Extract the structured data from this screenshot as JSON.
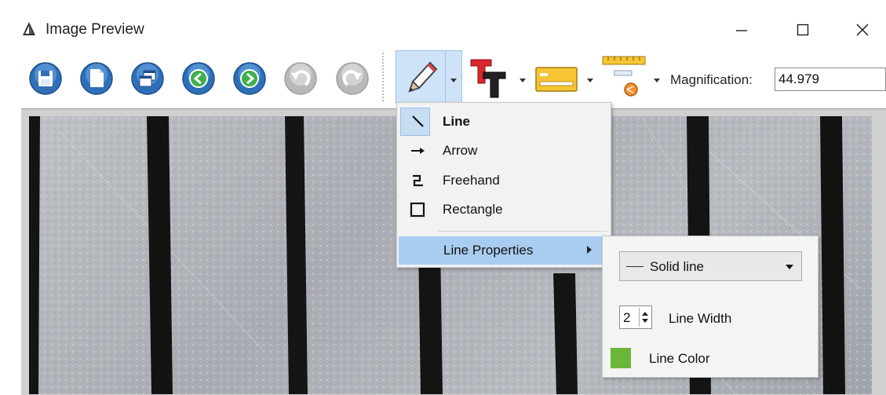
{
  "window": {
    "title": "Image Preview"
  },
  "window_controls": {
    "minimize": "—",
    "maximize": "☐",
    "close": "✕"
  },
  "toolbar": {
    "buttons": [
      {
        "name": "save-icon"
      },
      {
        "name": "new-document-icon"
      },
      {
        "name": "windows-icon"
      },
      {
        "name": "back-arrow-icon"
      },
      {
        "name": "forward-arrow-icon"
      },
      {
        "name": "undo-icon"
      },
      {
        "name": "redo-icon"
      }
    ],
    "magnification_label": "Magnification:",
    "magnification_value": "44.979"
  },
  "draw_menu": {
    "items": [
      {
        "label": "Line",
        "icon": "line-icon",
        "selected": true
      },
      {
        "label": "Arrow",
        "icon": "arrow-icon"
      },
      {
        "label": "Freehand",
        "icon": "freehand-icon"
      },
      {
        "label": "Rectangle",
        "icon": "rectangle-icon"
      }
    ],
    "properties_label": "Line Properties"
  },
  "line_properties": {
    "style": "Solid line",
    "width_value": "2",
    "width_label": "Line Width",
    "color_label": "Line Color",
    "color": "#6ab73a"
  },
  "colors": {
    "toolbar_button_blue": "#2f6fb8",
    "menu_highlight": "#a9cdf0",
    "pencil_group_bg": "#cfe3f8"
  }
}
